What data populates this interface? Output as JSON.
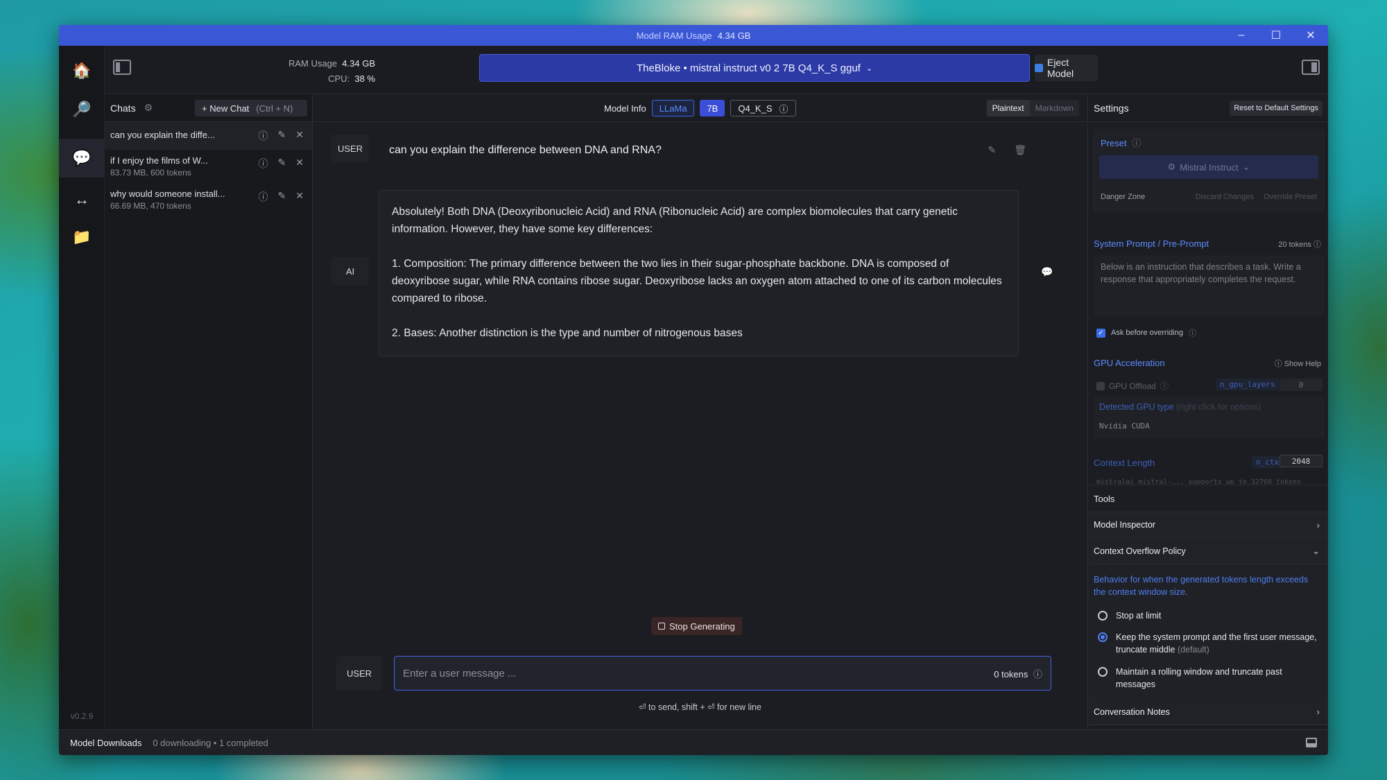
{
  "window": {
    "title_label": "Model RAM Usage",
    "title_value": "4.34 GB",
    "controls": {
      "minimize": "–",
      "maximize": "☐",
      "close": "✕"
    }
  },
  "rail": {
    "items": [
      {
        "name": "home",
        "icon": "🏠"
      },
      {
        "name": "search",
        "icon": "🔎"
      },
      {
        "name": "chat",
        "icon": "💬"
      },
      {
        "name": "server",
        "icon": "↔"
      },
      {
        "name": "folder",
        "icon": "📁"
      }
    ],
    "version": "v0.2.9"
  },
  "topbar": {
    "ram_label": "RAM Usage",
    "ram_value": "4.34 GB",
    "cpu_label": "CPU:",
    "cpu_value": "38 %",
    "model_selector": "TheBloke • mistral instruct v0 2 7B Q4_K_S gguf",
    "eject_label": "Eject Model"
  },
  "chatlist": {
    "title": "Chats",
    "new_chat_label": "+ New Chat",
    "new_chat_shortcut": "(Ctrl + N)",
    "items": [
      {
        "title": "can you explain the diffe...",
        "meta": ""
      },
      {
        "title": "if I enjoy the films of W...",
        "meta": "83.73 MB, 600 tokens"
      },
      {
        "title": "why would someone install...",
        "meta": "66.69 MB, 470 tokens"
      }
    ]
  },
  "conversation": {
    "model_info_label": "Model Info",
    "badges": {
      "arch": "LLaMa",
      "size": "7B",
      "quant": "Q4_K_S"
    },
    "view_modes": {
      "plaintext": "Plaintext",
      "markdown": "Markdown"
    },
    "user_role": "USER",
    "user_message": "can you explain the difference between DNA and RNA?",
    "ai_role": "AI",
    "ai_paragraphs": [
      " Absolutely! Both DNA (Deoxyribonucleic Acid) and RNA (Ribonucleic Acid) are complex biomolecules that carry genetic information. However, they have some key differences:",
      "1. Composition: The primary difference between the two lies in their sugar-phosphate backbone. DNA is composed of deoxyribose sugar, while RNA contains ribose sugar. Deoxyribose lacks an oxygen atom attached to one of its carbon molecules compared to ribose.",
      "2. Bases: Another distinction is the type and number of nitrogenous bases"
    ],
    "stop_label": "Stop Generating",
    "input_role": "USER",
    "input_placeholder": "Enter a user message ...",
    "input_tokens": "0 tokens",
    "send_hint": "⏎ to send, shift + ⏎ for new line"
  },
  "settings": {
    "title": "Settings",
    "reset_label": "Reset to Default Settings",
    "preset_label": "Preset",
    "preset_value": "Mistral Instruct",
    "danger_zone": "Danger Zone",
    "discard_changes": "Discard Changes",
    "override_preset": "Override Preset",
    "system_prompt_label": "System Prompt / Pre-Prompt",
    "system_prompt_tokens": "20 tokens",
    "system_prompt_text": "Below is an instruction that describes a task. Write a response that appropriately completes the request.",
    "ask_before_overriding": "Ask before overriding",
    "gpu_label": "GPU Acceleration",
    "show_help": "Show Help",
    "gpu_offload": "GPU Offload",
    "n_gpu_layers": "n_gpu_layers",
    "n_gpu_layers_value": "0",
    "detected_gpu_label": "Detected GPU type",
    "detected_gpu_hint": "(right click for options)",
    "detected_gpu_value": "Nvidia CUDA",
    "context_length_label": "Context Length",
    "n_ctx": "n_ctx",
    "n_ctx_value": "2048",
    "context_note": "mistralai_mistral-...  supports up to 32768 tokens",
    "tools_title": "Tools",
    "model_inspector": "Model Inspector",
    "context_overflow": "Context Overflow Policy",
    "overflow_desc": "Behavior for when the generated tokens length exceeds the context window size.",
    "overflow_options": [
      {
        "label": "Stop at limit",
        "note": ""
      },
      {
        "label": "Keep the system prompt and the first user message, truncate middle",
        "note": "(default)"
      },
      {
        "label": "Maintain a rolling window and truncate past messages",
        "note": ""
      }
    ],
    "conversation_notes": "Conversation Notes"
  },
  "statusbar": {
    "downloads_label": "Model Downloads",
    "downloads_status": "0 downloading • 1 completed"
  }
}
